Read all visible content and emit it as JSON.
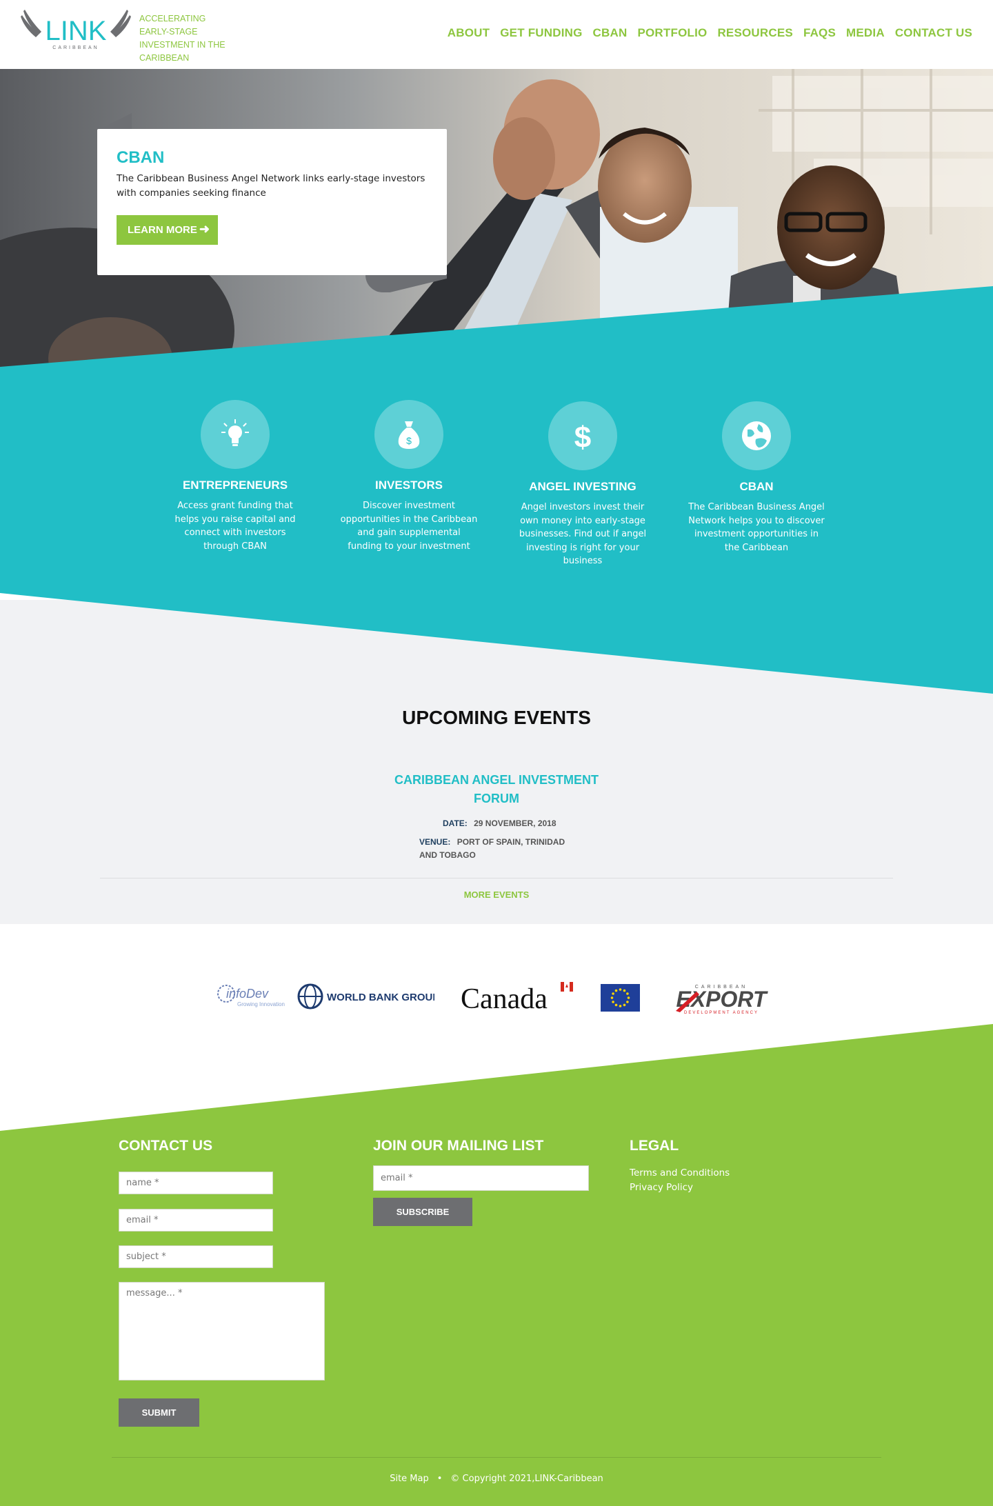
{
  "header": {
    "logo_text": "LINK",
    "logo_subtext": "CARIBBEAN",
    "tagline": "ACCELERATING EARLY-STAGE INVESTMENT IN THE CARIBBEAN",
    "nav": [
      "ABOUT",
      "GET FUNDING",
      "CBAN",
      "PORTFOLIO",
      "RESOURCES",
      "FAQS",
      "MEDIA",
      "CONTACT US"
    ]
  },
  "hero": {
    "title": "CBAN",
    "text": "The Caribbean Business Angel Network links early-stage investors with companies seeking finance",
    "button": "LEARN MORE",
    "button_icon": "arrow-right-icon"
  },
  "features": [
    {
      "icon": "lightbulb-icon",
      "title": "ENTREPRENEURS",
      "text": "Access grant funding that helps you raise capital and connect with investors through CBAN"
    },
    {
      "icon": "money-bag-icon",
      "title": "INVESTORS",
      "text": "Discover investment opportunities in the Caribbean and gain supplemental funding to your investment"
    },
    {
      "icon": "dollar-icon",
      "title": "ANGEL INVESTING",
      "text": "Angel investors invest their own money into early-stage businesses. Find out if angel investing is right for your business"
    },
    {
      "icon": "globe-icon",
      "title": "CBAN",
      "text": "The Caribbean Business Angel Network helps you to discover investment opportunities in the Caribbean"
    }
  ],
  "events": {
    "title": "UPCOMING EVENTS",
    "event_name": "CARIBBEAN ANGEL INVESTMENT FORUM",
    "date_label": "DATE:",
    "date": "29 NOVEMBER, 2018",
    "venue_label": "VENUE:",
    "venue": "PORT OF SPAIN, TRINIDAD AND TOBAGO",
    "more": "MORE EVENTS"
  },
  "partners": {
    "infodev": "infoDev",
    "infodev_sub": "Growing Innovation",
    "worldbank": "WORLD BANK GROUP",
    "canada": "Canada",
    "export_top": "CARIBBEAN",
    "export": "EXPORT",
    "export_sub": "DEVELOPMENT AGENCY"
  },
  "footer": {
    "contact_title": "CONTACT US",
    "name_ph": "name *",
    "email_ph": "email *",
    "subject_ph": "subject *",
    "message_ph": "message... *",
    "submit": "SUBMIT",
    "mailing_title": "JOIN OUR MAILING LIST",
    "mailing_email_ph": "email *",
    "subscribe": "SUBSCRIBE",
    "legal_title": "LEGAL",
    "terms": "Terms and Conditions",
    "privacy": "Privacy Policy",
    "sitemap": "Site Map",
    "copyright": "© Copyright 2021,LINK-Caribbean"
  },
  "colors": {
    "teal": "#21bec6",
    "green": "#8dc63f",
    "gray_button": "#6d6e71",
    "events_bg": "#f1f2f4"
  }
}
